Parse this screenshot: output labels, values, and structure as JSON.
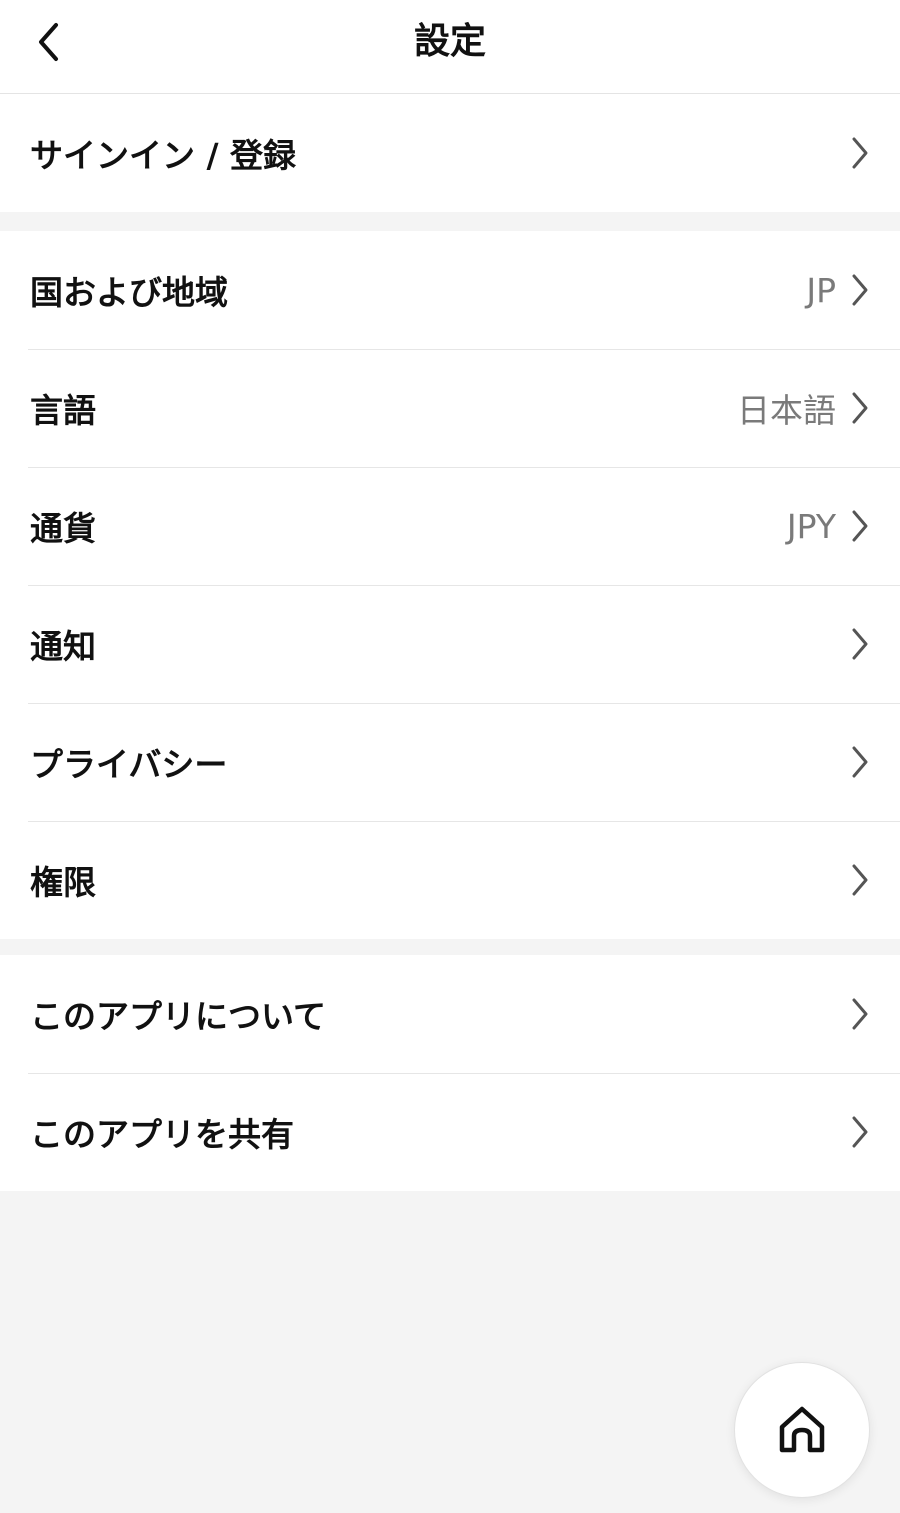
{
  "header": {
    "title": "設定",
    "back_icon": "chevron-left-icon"
  },
  "section1": {
    "items": [
      {
        "label": "サインイン / 登録"
      }
    ]
  },
  "section2": {
    "items": [
      {
        "label": "国および地域",
        "value": "JP"
      },
      {
        "label": "言語",
        "value": "日本語"
      },
      {
        "label": "通貨",
        "value": "JPY"
      },
      {
        "label": "通知"
      },
      {
        "label": "プライバシー"
      },
      {
        "label": "権限"
      }
    ]
  },
  "section3": {
    "items": [
      {
        "label": "このアプリについて"
      },
      {
        "label": "このアプリを共有"
      }
    ]
  },
  "home_button": {
    "icon": "home-icon"
  },
  "colors": {
    "background": "#f4f4f4",
    "surface": "#ffffff",
    "value_text": "#7a7a7a"
  }
}
